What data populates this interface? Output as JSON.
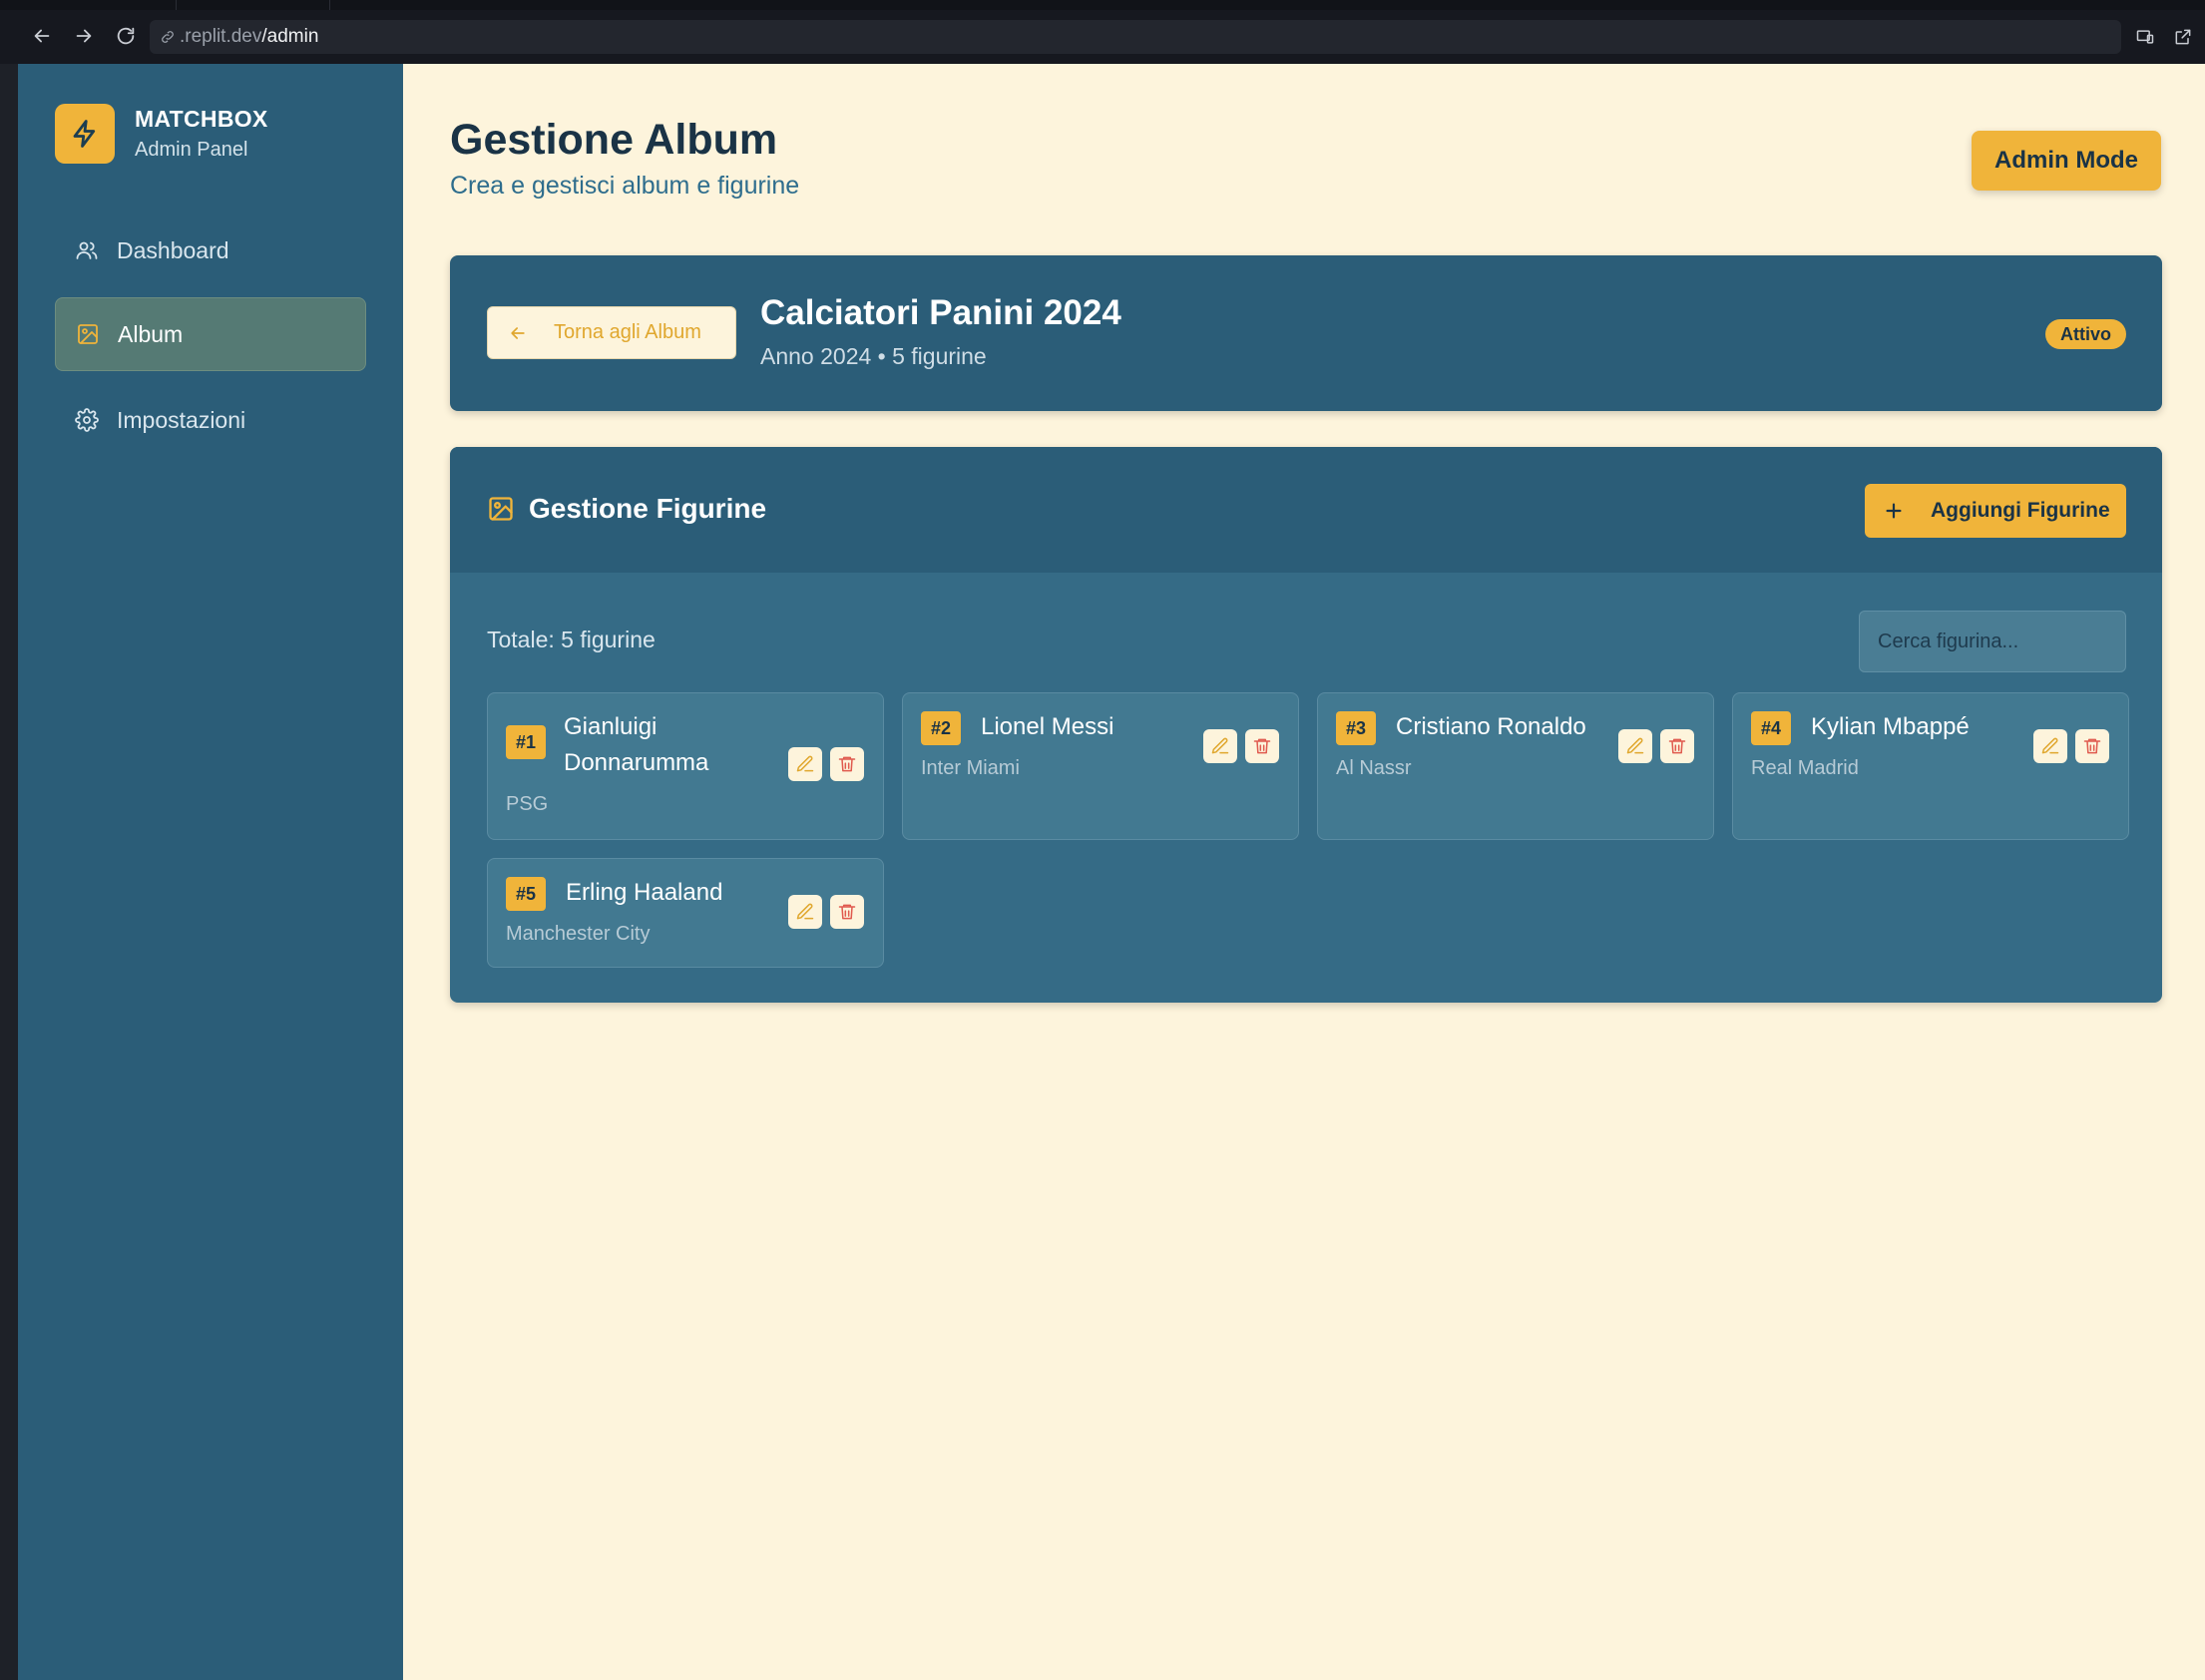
{
  "browser": {
    "url_host": ".replit.dev",
    "url_path": "/admin"
  },
  "brand": {
    "title": "MATCHBOX",
    "subtitle": "Admin Panel"
  },
  "sidebar": {
    "items": [
      {
        "label": "Dashboard",
        "icon": "users-icon",
        "active": false
      },
      {
        "label": "Album",
        "icon": "image-icon",
        "active": true
      },
      {
        "label": "Impostazioni",
        "icon": "gear-icon",
        "active": false
      }
    ]
  },
  "header": {
    "title": "Gestione Album",
    "subtitle": "Crea e gestisci album e figurine",
    "admin_button": "Admin Mode"
  },
  "album": {
    "back_label": "Torna agli Album",
    "name": "Calciatori Panini 2024",
    "meta": "Anno 2024 • 5 figurine",
    "status": "Attivo"
  },
  "stickers_panel": {
    "title": "Gestione Figurine",
    "add_button": "Aggiungi Figurine",
    "total": "Totale: 5 figurine",
    "search_placeholder": "Cerca figurina...",
    "stickers": [
      {
        "number": "#1",
        "name": "Gianluigi Donnarumma",
        "team": "PSG"
      },
      {
        "number": "#2",
        "name": "Lionel Messi",
        "team": "Inter Miami"
      },
      {
        "number": "#3",
        "name": "Cristiano Ronaldo",
        "team": "Al Nassr"
      },
      {
        "number": "#4",
        "name": "Kylian Mbappé",
        "team": "Real Madrid"
      },
      {
        "number": "#5",
        "name": "Erling Haaland",
        "team": "Manchester City"
      }
    ]
  },
  "colors": {
    "sidebar": "#2b5d78",
    "background": "#fdf4dc",
    "accent": "#f0b43a",
    "delete": "#e05a4e"
  }
}
